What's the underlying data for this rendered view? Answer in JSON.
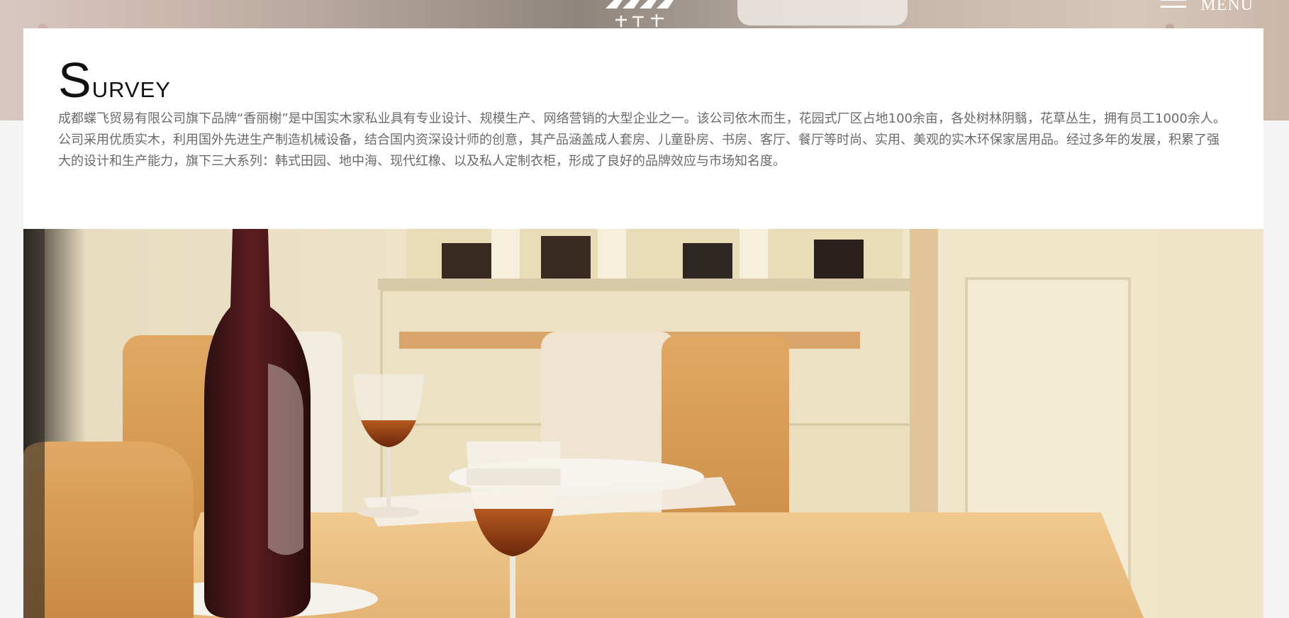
{
  "header": {
    "menu_label": "MENU"
  },
  "survey": {
    "title": "Survey",
    "description": "成都蝶飞贸易有限公司旗下品牌“香丽榭”是中国实木家私业具有专业设计、规模生产、网络营销的大型企业之一。该公司依木而生，花园式厂区占地100余亩，各处树林阴翳，花草丛生，拥有员工1000余人。公司采用优质实木，利用国外先进生产制造机械设备，结合国内资深设计师的创意，其产品涵盖成人套房、儿童卧房、书房、客厅、餐厅等时尚、实用、美观的实木环保家居用品。经过多年的发展，积累了强大的设计和生产能力，旗下三大系列：韩式田园、地中海、现代红橡、以及私人定制衣柜，形成了良好的品牌效应与市场知名度。"
  },
  "icons": {
    "logo": "brand-logo-icon",
    "menu": "hamburger-menu-icon"
  }
}
